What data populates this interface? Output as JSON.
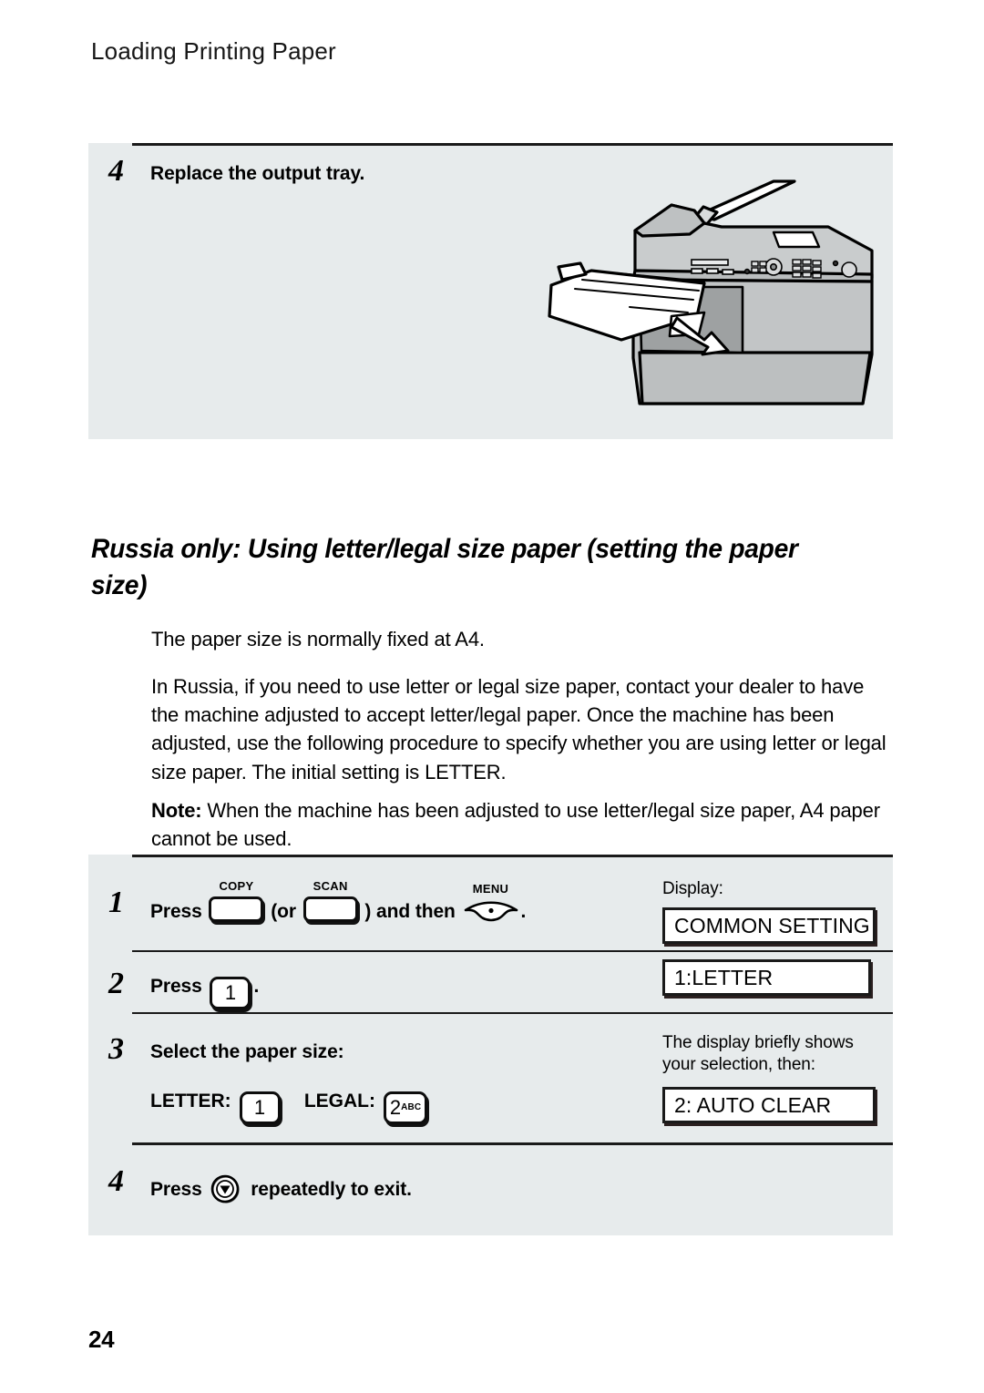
{
  "page": {
    "running_header": "Loading Printing Paper",
    "page_number": "24"
  },
  "illustration_step": {
    "number": "4",
    "text": "Replace the output tray.",
    "art_name": "fax-machine-output-tray-illustration"
  },
  "section": {
    "heading": "Russia only: Using letter/legal size paper (setting the paper size)"
  },
  "body": {
    "paragraph_1": "The paper size is normally fixed at A4.",
    "paragraph_2": "In Russia, if you need to use letter or legal size paper, contact your dealer to have the machine adjusted to accept letter/legal paper. Once the machine has been adjusted, use the following procedure to specify whether you are using letter or legal size paper. The initial setting is LETTER.",
    "note_label": "Note:",
    "note_text": " When the machine has been adjusted to use letter/legal size paper, A4 paper cannot be used."
  },
  "procedure": {
    "step1": {
      "number": "1",
      "text_press": "Press",
      "key_copy_label": "COPY",
      "text_or": "(or",
      "key_scan_label": "SCAN",
      "text_and_then": ") and then",
      "key_menu_label": "MENU",
      "text_period": ".",
      "display_caption": "Display:",
      "display_value": "COMMON SETTING"
    },
    "step2": {
      "number": "2",
      "text_press": "Press",
      "key_1": "1",
      "text_period": ".",
      "display_value": "1:LETTER"
    },
    "step3": {
      "number": "3",
      "text": "Select the paper size:",
      "letter_label": "LETTER:",
      "letter_key": "1",
      "legal_label": "LEGAL:",
      "legal_key": "2",
      "legal_key_sub": "ABC",
      "display_caption": "The display briefly shows your selection, then:",
      "display_value": "2: AUTO CLEAR"
    },
    "step4": {
      "number": "4",
      "text_press": "Press",
      "key_stop_name": "stop-button-icon",
      "text_after": "repeatedly to exit."
    }
  },
  "colors": {
    "panel_background": "#e7ebec",
    "page_background": "#ffffff",
    "ink": "#000000"
  }
}
